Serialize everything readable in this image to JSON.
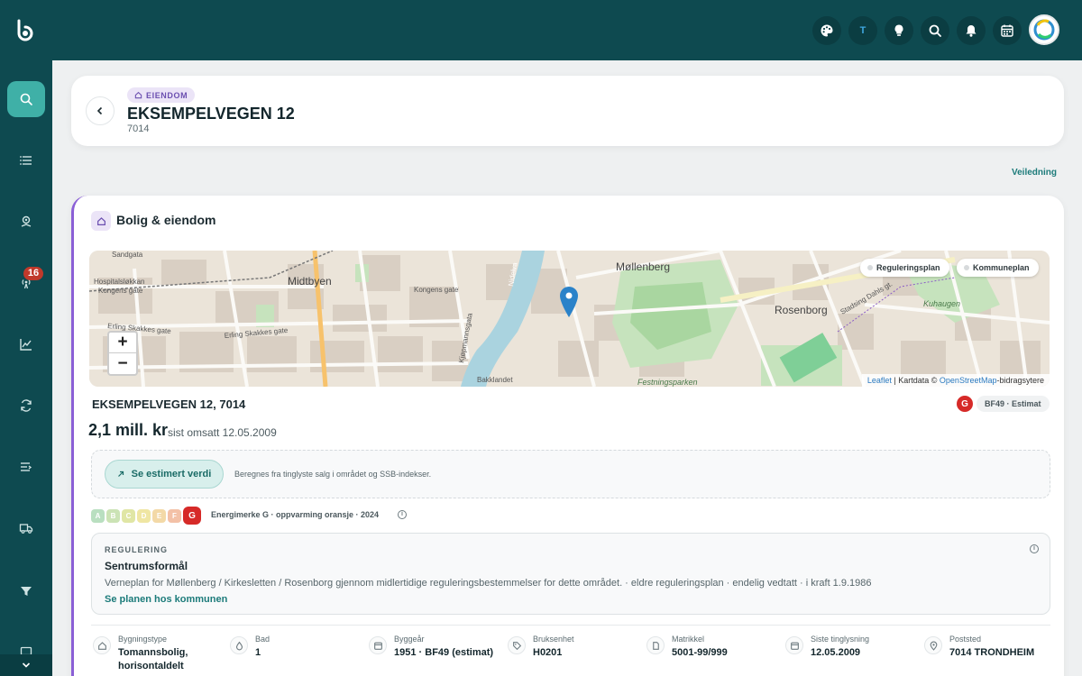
{
  "sidebar": {
    "badge": "16",
    "items": [
      {
        "icon": "search-icon"
      },
      {
        "icon": "list-icon"
      },
      {
        "icon": "map-pin-icon"
      },
      {
        "icon": "broadcast-icon"
      },
      {
        "icon": "chart-line-icon"
      },
      {
        "icon": "refresh-icon"
      },
      {
        "icon": "list-edit-icon"
      },
      {
        "icon": "truck-icon"
      },
      {
        "icon": "filter-icon"
      },
      {
        "icon": "monitor-icon"
      }
    ]
  },
  "topbar": {
    "icons": [
      "palette-icon",
      "translate-icon",
      "lightbulb-icon",
      "search-icon",
      "bell-icon",
      "calendar-icon",
      "avatar"
    ],
    "translate_label": "T"
  },
  "header": {
    "tag": "EIENDOM",
    "title": "EKSEMPELVEGEN 12",
    "subtitle": "7014"
  },
  "veiledning": "Veiledning",
  "section": {
    "title": "Bolig & eiendom"
  },
  "map": {
    "pills": [
      "Reguleringsplan",
      "Kommuneplan"
    ],
    "zoom_in": "+",
    "zoom_out": "−",
    "attribution_leaflet": "Leaflet",
    "attribution_text": " | Kartdata © ",
    "attribution_osm": "OpenStreetMap",
    "attribution_suffix": "-bidragsytere",
    "labels": [
      "Sandgata",
      "Hospitalsløkkan",
      "Kongens gate",
      "Midtbyen",
      "Kongens gate",
      "Erling Skakkes gate",
      "Erling Skakkes gate",
      "Kjøpmannsgata",
      "Nidelva",
      "Bakklandet",
      "Møllenberg",
      "Rosenborg",
      "Festningsparken",
      "Kuhaugen",
      "Stadsing Dahls gt."
    ]
  },
  "property": {
    "address": "EKSEMPELVEGEN 12, 7014",
    "energy_badge": "G",
    "bf_pill": "BF49 · Estimat",
    "price": "2,1 mill. kr",
    "sold_text": "sist omsatt 12.05.2009"
  },
  "estimate": {
    "button": "Se estimert verdi",
    "text": "Beregnes fra tinglyste salg i området og SSB-indekser."
  },
  "energy": {
    "grades": [
      {
        "letter": "A",
        "color": "#b9dfc0"
      },
      {
        "letter": "B",
        "color": "#cbe3b5"
      },
      {
        "letter": "C",
        "color": "#e0e6a5"
      },
      {
        "letter": "D",
        "color": "#efe6a3"
      },
      {
        "letter": "E",
        "color": "#f3d9a7"
      },
      {
        "letter": "F",
        "color": "#f3c1a7"
      },
      {
        "letter": "G",
        "color": "#d62a28"
      }
    ],
    "selected": "G",
    "text": "Energimerke G · oppvarming oransje · 2024"
  },
  "regulering": {
    "heading": "REGULERING",
    "title": "Sentrumsformål",
    "description": "Verneplan for Møllenberg / Kirkesletten / Rosenborg gjennom midlertidige reguleringsbestemmelser for dette området. · eldre reguleringsplan · endelig vedtatt · i kraft 1.9.1986",
    "link": "Se planen hos kommunen"
  },
  "facts": [
    {
      "label": "Bygningstype",
      "value": "Tomannsbolig, horisontaldelt",
      "icon": "home-icon"
    },
    {
      "label": "Bad",
      "value": "1",
      "icon": "drop-icon"
    },
    {
      "label": "Byggeår",
      "value": "1951 · BF49 (estimat)",
      "icon": "calendar-icon"
    },
    {
      "label": "Bruksenhet",
      "value": "H0201",
      "icon": "tag-icon"
    },
    {
      "label": "Matrikkel",
      "value": "5001-99/999",
      "icon": "document-icon"
    },
    {
      "label": "Siste tinglysning",
      "value": "12.05.2009",
      "icon": "calendar-icon"
    },
    {
      "label": "Poststed",
      "value": "7014 TRONDHEIM",
      "icon": "location-icon"
    }
  ]
}
